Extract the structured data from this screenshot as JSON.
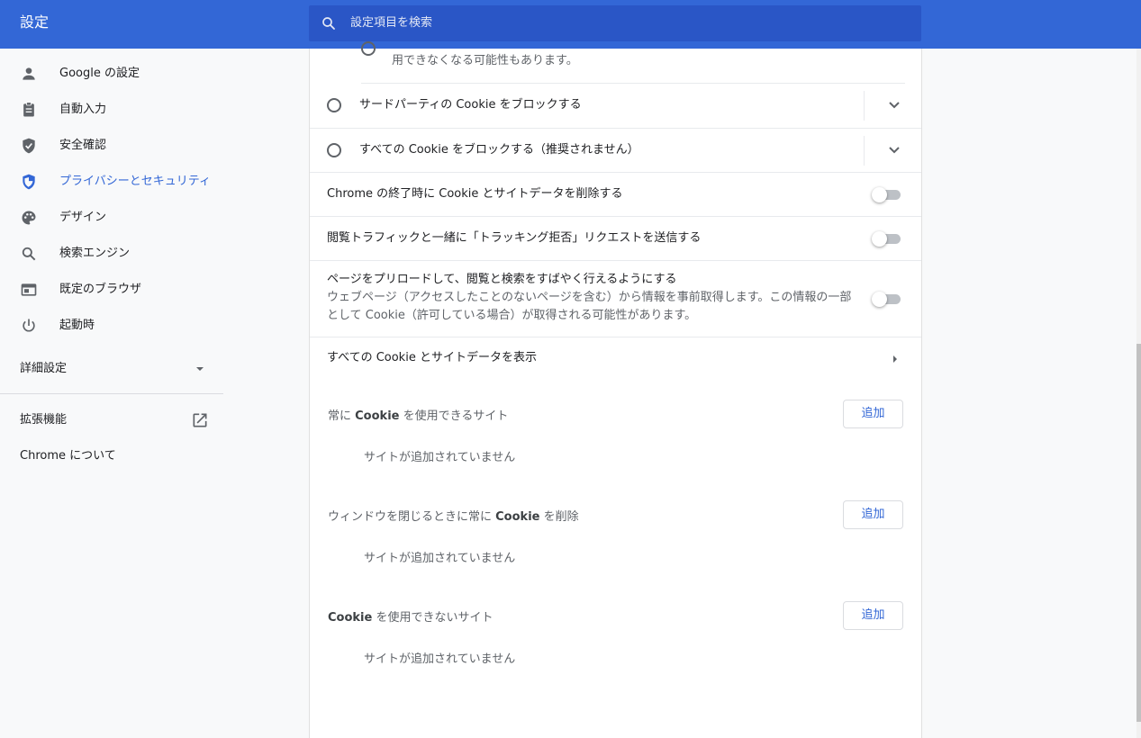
{
  "header": {
    "title": "設定",
    "search_placeholder": "設定項目を検索"
  },
  "sidebar": {
    "items": [
      {
        "label": "Google の設定",
        "icon": "person-icon"
      },
      {
        "label": "自動入力",
        "icon": "clipboard-icon"
      },
      {
        "label": "安全確認",
        "icon": "shield-check-icon"
      },
      {
        "label": "プライバシーとセキュリティ",
        "icon": "shield-icon",
        "active": true
      },
      {
        "label": "デザイン",
        "icon": "palette-icon"
      },
      {
        "label": "検索エンジン",
        "icon": "search-icon"
      },
      {
        "label": "既定のブラウザ",
        "icon": "browser-icon"
      },
      {
        "label": "起動時",
        "icon": "power-icon"
      }
    ],
    "advanced_label": "詳細設定",
    "extensions_label": "拡張機能",
    "about_label": "Chrome について"
  },
  "main": {
    "partial_text": "用できなくなる可能性もあります。",
    "radio_third_party": "サードパーティの Cookie をブロックする",
    "radio_block_all": "すべての Cookie をブロックする（推奨されません）",
    "clear_on_exit": "Chrome の終了時に Cookie とサイトデータを削除する",
    "do_not_track": "閲覧トラフィックと一緒に「トラッキング拒否」リクエストを送信する",
    "preload_title": "ページをプリロードして、閲覧と検索をすばやく行えるようにする",
    "preload_desc": "ウェブページ（アクセスしたことのないページを含む）から情報を事前取得します。この情報の一部として Cookie（許可している場合）が取得される可能性があります。",
    "see_all_cookies": "すべての Cookie とサイトデータを表示",
    "toggles": {
      "clear_on_exit": false,
      "do_not_track": false,
      "preload": false
    },
    "lists": [
      {
        "heading_pre": "常に ",
        "heading_bold": "Cookie",
        "heading_post": " を使用できるサイト",
        "button": "追加",
        "empty": "サイトが追加されていません"
      },
      {
        "heading_pre": "ウィンドウを閉じるときに常に ",
        "heading_bold": "Cookie",
        "heading_post": " を削除",
        "button": "追加",
        "empty": "サイトが追加されていません"
      },
      {
        "heading_pre": "",
        "heading_bold": "Cookie",
        "heading_post": " を使用できないサイト",
        "button": "追加",
        "empty": "サイトが追加されていません"
      }
    ]
  },
  "colors": {
    "header_bg": "#3367d6",
    "search_bg": "#2a56c6",
    "accent": "#3367d6"
  }
}
